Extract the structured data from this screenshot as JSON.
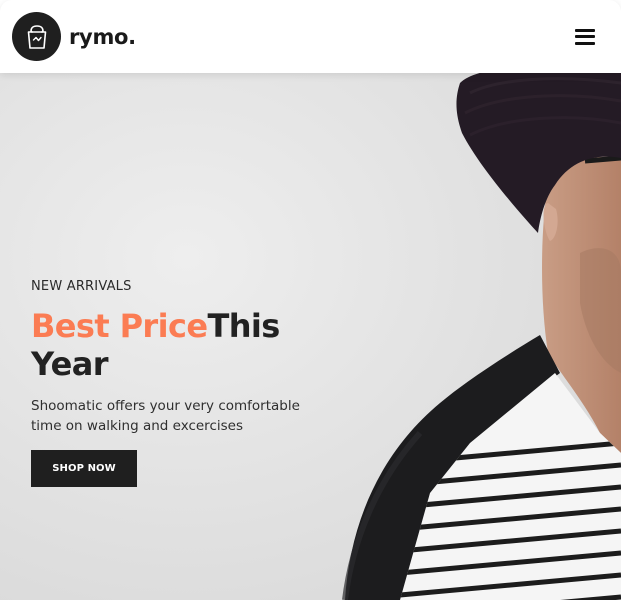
{
  "header": {
    "brand_name": "rymo.",
    "logo_icon": "shopping-bag-icon",
    "menu_icon": "hamburger-menu-icon"
  },
  "hero": {
    "eyebrow": "NEW ARRIVALS",
    "headline_accent": "Best Price",
    "headline_rest": "This Year",
    "description": "Shoomatic offers your very comfortable time on walking and excercises",
    "cta_label": "SHOP NOW"
  },
  "colors": {
    "accent": "#fb7c53",
    "dark": "#1f1f1f",
    "background": "#e6e6e6"
  }
}
